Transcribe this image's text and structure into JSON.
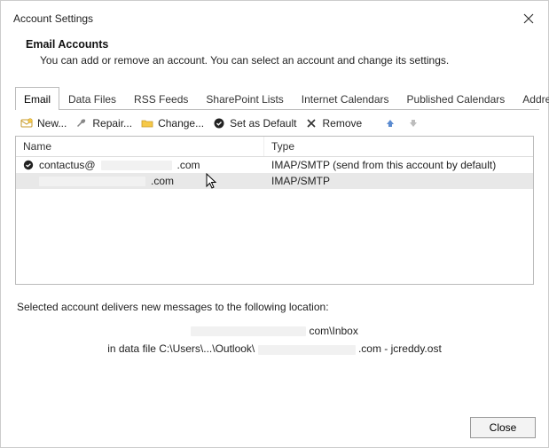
{
  "window": {
    "title": "Account Settings"
  },
  "header": {
    "title": "Email Accounts",
    "desc": "You can add or remove an account. You can select an account and change its settings."
  },
  "tabs": {
    "items": [
      {
        "label": "Email"
      },
      {
        "label": "Data Files"
      },
      {
        "label": "RSS Feeds"
      },
      {
        "label": "SharePoint Lists"
      },
      {
        "label": "Internet Calendars"
      },
      {
        "label": "Published Calendars"
      },
      {
        "label": "Address Books"
      }
    ],
    "active_index": 0
  },
  "toolbar": {
    "new": "New...",
    "repair": "Repair...",
    "change": "Change...",
    "set_default": "Set as Default",
    "remove": "Remove"
  },
  "list": {
    "col_name": "Name",
    "col_type": "Type",
    "rows": [
      {
        "is_default": true,
        "selected": false,
        "name_prefix": "contactus@",
        "name_suffix": ".com",
        "type": "IMAP/SMTP (send from this account by default)"
      },
      {
        "is_default": false,
        "selected": true,
        "name_prefix": "",
        "name_suffix": ".com",
        "type": "IMAP/SMTP"
      }
    ]
  },
  "delivery": {
    "intro": "Selected account delivers new messages to the following location:",
    "loc_suffix": "com\\Inbox",
    "path_prefix": "in data file C:\\Users\\...\\Outlook\\",
    "path_suffix": ".com - jcreddy.ost"
  },
  "footer": {
    "close": "Close"
  }
}
